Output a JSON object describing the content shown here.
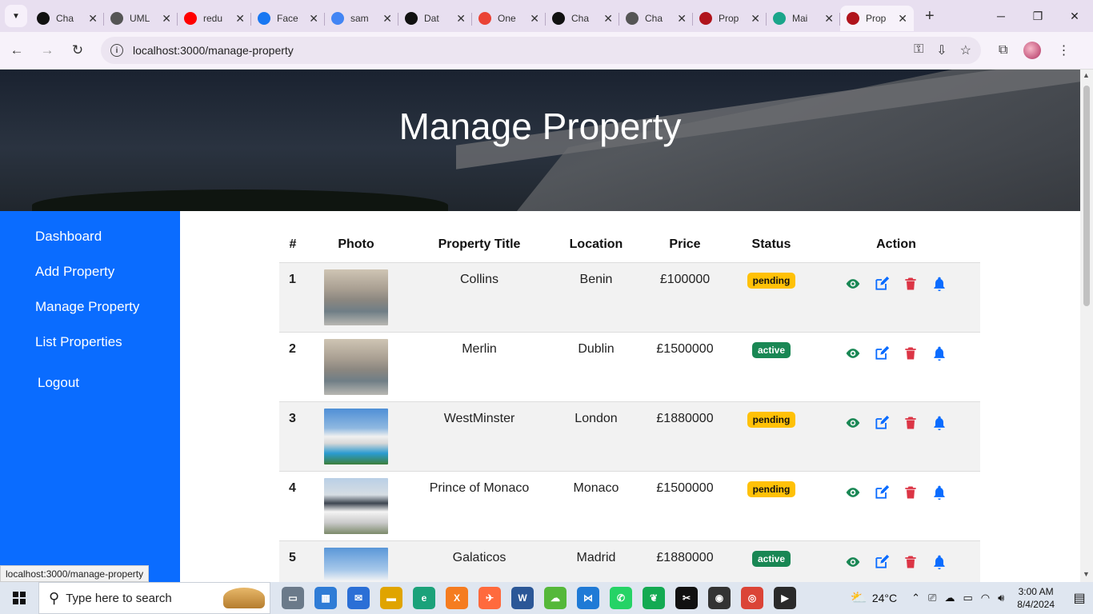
{
  "browser": {
    "tabs": [
      {
        "title": "Cha",
        "favicon": "openai-icon",
        "color": "#111111"
      },
      {
        "title": "UML",
        "favicon": "openai-icon",
        "color": "#555555"
      },
      {
        "title": "redu",
        "favicon": "youtube-icon",
        "color": "#ff0000"
      },
      {
        "title": "Face",
        "favicon": "facebook-icon",
        "color": "#1877f2"
      },
      {
        "title": "sam",
        "favicon": "google-icon",
        "color": "#4285f4"
      },
      {
        "title": "Dat",
        "favicon": "mongodb-icon",
        "color": "#111111"
      },
      {
        "title": "One",
        "favicon": "gmail-icon",
        "color": "#ea4335"
      },
      {
        "title": "Cha",
        "favicon": "openai-icon",
        "color": "#111111"
      },
      {
        "title": "Cha",
        "favicon": "openai-icon",
        "color": "#555555"
      },
      {
        "title": "Prop",
        "favicon": "pr-icon",
        "color": "#b0141c"
      },
      {
        "title": "Mai",
        "favicon": "mail-icon",
        "color": "#1aa58a"
      },
      {
        "title": "Prop",
        "favicon": "pr-icon",
        "color": "#b0141c"
      }
    ],
    "url": "localhost:3000/manage-property",
    "status_url": "localhost:3000/manage-property"
  },
  "page": {
    "title": "Manage Property",
    "sidebar": [
      "Dashboard",
      "Add Property",
      "Manage Property",
      "List Properties",
      "Logout"
    ],
    "table": {
      "headers": [
        "#",
        "Photo",
        "Property Title",
        "Location",
        "Price",
        "Status",
        "Action"
      ],
      "rows": [
        {
          "num": "1",
          "photo": "living-room",
          "title": "Collins",
          "location": "Benin",
          "price": "£100000",
          "status": "pending"
        },
        {
          "num": "2",
          "photo": "living-room",
          "title": "Merlin",
          "location": "Dublin",
          "price": "£1500000",
          "status": "active"
        },
        {
          "num": "3",
          "photo": "modern-villa-pool",
          "title": "WestMinster",
          "location": "London",
          "price": "£1880000",
          "status": "pending"
        },
        {
          "num": "4",
          "photo": "suburban-house",
          "title": "Prince of Monaco",
          "location": "Monaco",
          "price": "£1500000",
          "status": "pending"
        },
        {
          "num": "5",
          "photo": "modern-villa",
          "title": "Galaticos",
          "location": "Madrid",
          "price": "£1880000",
          "status": "active"
        }
      ]
    },
    "colors": {
      "sidebar": "#0a6cff",
      "view": "#198754",
      "edit": "#0a6cff",
      "delete": "#dc3545",
      "notify": "#0a6cff",
      "pending": "#ffc107",
      "active": "#198754"
    }
  },
  "taskbar": {
    "search_placeholder": "Type here to search",
    "temperature": "24°C",
    "time": "3:00 AM",
    "date": "8/4/2024"
  }
}
